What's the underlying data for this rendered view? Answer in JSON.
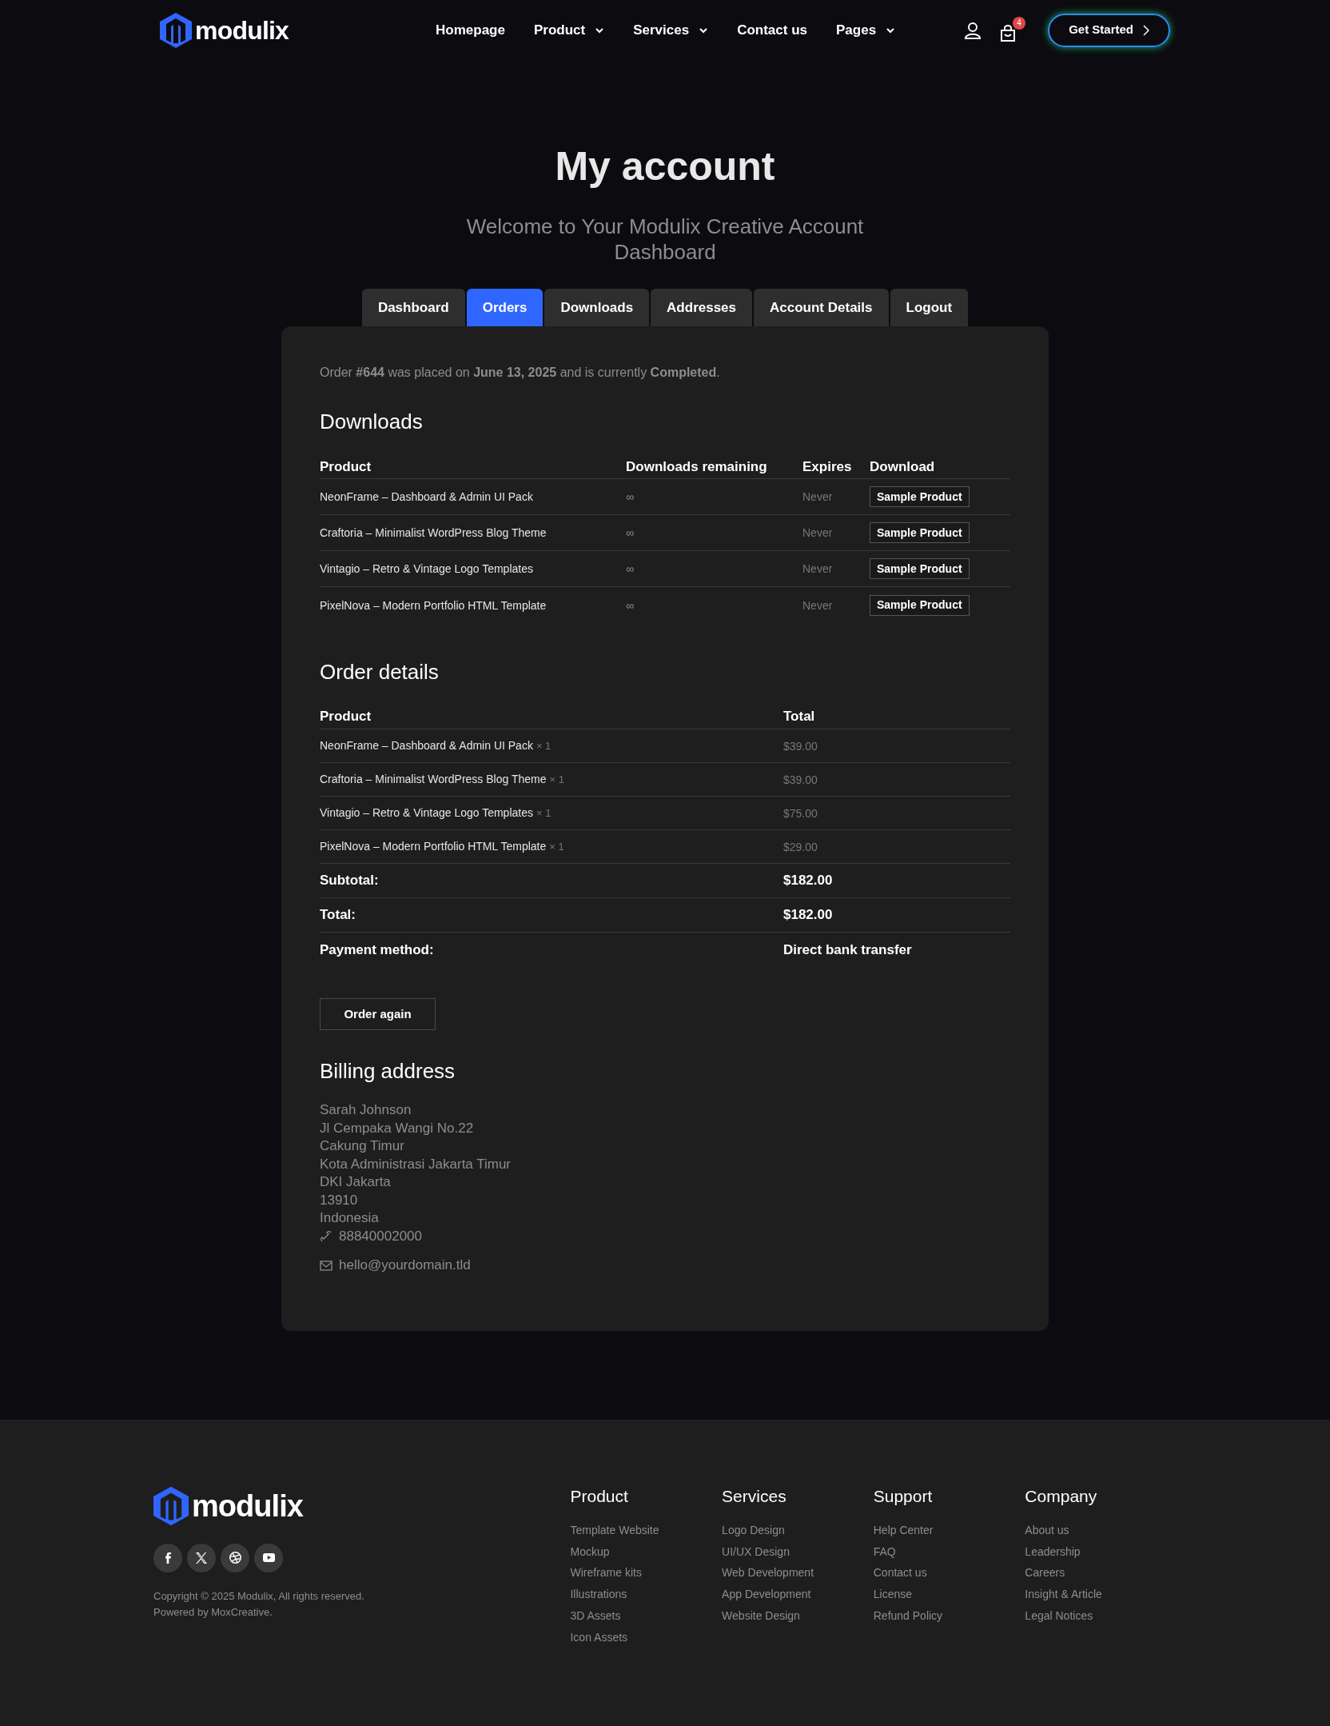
{
  "header": {
    "logo": "modulix",
    "nav": [
      {
        "label": "Homepage",
        "dropdown": false
      },
      {
        "label": "Product",
        "dropdown": true
      },
      {
        "label": "Services",
        "dropdown": true
      },
      {
        "label": "Contact us",
        "dropdown": false
      },
      {
        "label": "Pages",
        "dropdown": true
      }
    ],
    "cart_count": "4",
    "cta": "Get Started"
  },
  "hero": {
    "title": "My account",
    "subtitle": "Welcome to Your Modulix Creative Account Dashboard"
  },
  "tabs": [
    {
      "label": "Dashboard",
      "selected": false
    },
    {
      "label": "Orders",
      "selected": true
    },
    {
      "label": "Downloads",
      "selected": false
    },
    {
      "label": "Addresses",
      "selected": false
    },
    {
      "label": "Account Details",
      "selected": false
    },
    {
      "label": "Logout",
      "selected": false
    }
  ],
  "order_summary": "Order **#644** was placed on **June 13, 2025** and is currently **Completed**.",
  "downloads": {
    "title": "Downloads",
    "columns": [
      "Product",
      "Downloads remaining",
      "Expires",
      "Download"
    ],
    "rows": [
      {
        "product": "NeonFrame – Dashboard & Admin UI Pack",
        "remaining": "∞",
        "expires": "Never",
        "file": "Sample Product"
      },
      {
        "product": "Craftoria – Minimalist WordPress Blog Theme",
        "remaining": "∞",
        "expires": "Never",
        "file": "Sample Product"
      },
      {
        "product": "Vintagio – Retro & Vintage Logo Templates",
        "remaining": "∞",
        "expires": "Never",
        "file": "Sample Product"
      },
      {
        "product": "PixelNova – Modern Portfolio HTML Template",
        "remaining": "∞",
        "expires": "Never",
        "file": "Sample Product"
      }
    ]
  },
  "order_details": {
    "title": "Order details",
    "columns": [
      "Product",
      "Total"
    ],
    "rows": [
      {
        "product": "NeonFrame – Dashboard & Admin UI Pack",
        "quantity": "× 1",
        "total": "$39.00"
      },
      {
        "product": "Craftoria – Minimalist WordPress Blog Theme",
        "quantity": "× 1",
        "total": "$39.00"
      },
      {
        "product": "Vintagio – Retro & Vintage Logo Templates",
        "quantity": "× 1",
        "total": "$75.00"
      },
      {
        "product": "PixelNova – Modern Portfolio HTML Template",
        "quantity": "× 1",
        "total": "$29.00"
      }
    ],
    "summary": [
      {
        "label": "Subtotal:",
        "value": "$182.00"
      },
      {
        "label": "Total:",
        "value": "$182.00"
      },
      {
        "label": "Payment method:",
        "value": "Direct bank transfer"
      }
    ],
    "button": "Order again"
  },
  "billing": {
    "title": "Billing address",
    "lines": [
      "Sarah Johnson",
      "Jl Cempaka Wangi No.22",
      "Cakung Timur",
      "Kota Administrasi Jakarta Timur",
      "DKI Jakarta",
      "13910",
      "Indonesia"
    ],
    "phone": "88840002000",
    "email": "hello@yourdomain.tld"
  },
  "footer": {
    "logo": "modulix",
    "socials": [
      {
        "kind": "facebook"
      },
      {
        "kind": "x"
      },
      {
        "kind": "dribbble"
      },
      {
        "kind": "youtube"
      }
    ],
    "copyright": "Copyright © 2025 Modulix, All rights reserved.",
    "powered": "Powered by MoxCreative.",
    "columns": [
      {
        "title": "Product",
        "links": [
          "Template Website",
          "Mockup",
          "Wireframe kits",
          "Illustrations",
          "3D Assets",
          "Icon Assets"
        ]
      },
      {
        "title": "Services",
        "links": [
          "Logo Design",
          "UI/UX Design",
          "Web Development",
          "App Development",
          "Website Design"
        ]
      },
      {
        "title": "Support",
        "links": [
          "Help Center",
          "FAQ",
          "Contact us",
          "License",
          "Refund Policy"
        ]
      },
      {
        "title": "Company",
        "links": [
          "About us",
          "Leadership",
          "Careers",
          "Insight & Article",
          "Legal Notices"
        ]
      }
    ]
  }
}
